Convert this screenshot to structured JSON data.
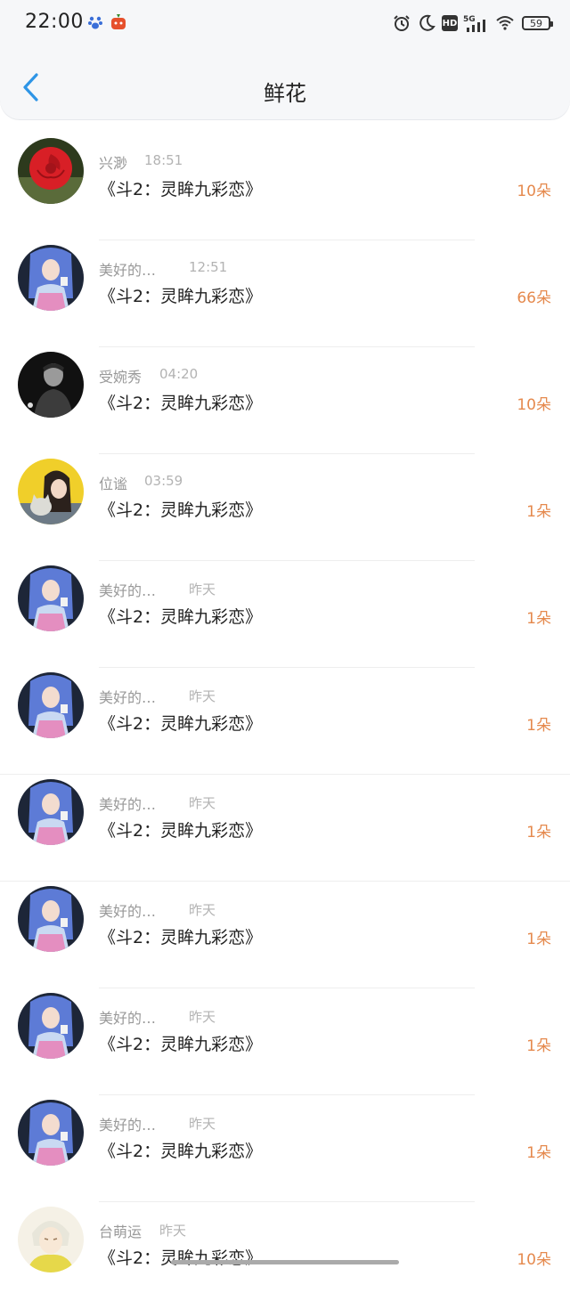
{
  "status_bar": {
    "time": "22:00",
    "network": "5G",
    "hd_label": "HD",
    "battery": "59",
    "icons": [
      "paw-app-icon",
      "tomato-app-icon",
      "alarm-icon",
      "moon-icon",
      "hd-icon",
      "signal-icon",
      "wifi-icon",
      "battery-icon"
    ]
  },
  "header": {
    "title": "鲜花",
    "back_icon": "chevron-left-icon",
    "accent_color": "#2e95e6"
  },
  "list": [
    {
      "name": "兴渺",
      "time": "18:51",
      "title": "《斗2：灵眸九彩恋》",
      "count": "10朵",
      "avatar": "rose"
    },
    {
      "name": "美好的…",
      "time": "12:51",
      "title": "《斗2：灵眸九彩恋》",
      "count": "66朵",
      "avatar": "anime"
    },
    {
      "name": "受婉秀",
      "time": "04:20",
      "title": "《斗2：灵眸九彩恋》",
      "count": "10朵",
      "avatar": "man"
    },
    {
      "name": "位谧",
      "time": "03:59",
      "title": "《斗2：灵眸九彩恋》",
      "count": "1朵",
      "avatar": "girl-cat"
    },
    {
      "name": "美好的…",
      "time": "昨天",
      "title": "《斗2：灵眸九彩恋》",
      "count": "1朵",
      "avatar": "anime"
    },
    {
      "name": "美好的…",
      "time": "昨天",
      "title": "《斗2：灵眸九彩恋》",
      "count": "1朵",
      "avatar": "anime"
    },
    {
      "name": "美好的…",
      "time": "昨天",
      "title": "《斗2：灵眸九彩恋》",
      "count": "1朵",
      "avatar": "anime"
    },
    {
      "name": "美好的…",
      "time": "昨天",
      "title": "《斗2：灵眸九彩恋》",
      "count": "1朵",
      "avatar": "anime"
    },
    {
      "name": "美好的…",
      "time": "昨天",
      "title": "《斗2：灵眸九彩恋》",
      "count": "1朵",
      "avatar": "anime"
    },
    {
      "name": "美好的…",
      "time": "昨天",
      "title": "《斗2：灵眸九彩恋》",
      "count": "1朵",
      "avatar": "anime"
    },
    {
      "name": "台萌运",
      "time": "昨天",
      "title": "《斗2：灵眸九彩恋》",
      "count": "10朵",
      "avatar": "white-hair"
    }
  ],
  "colors": {
    "count": "#e5894d",
    "name": "#999999",
    "title": "#222222"
  }
}
